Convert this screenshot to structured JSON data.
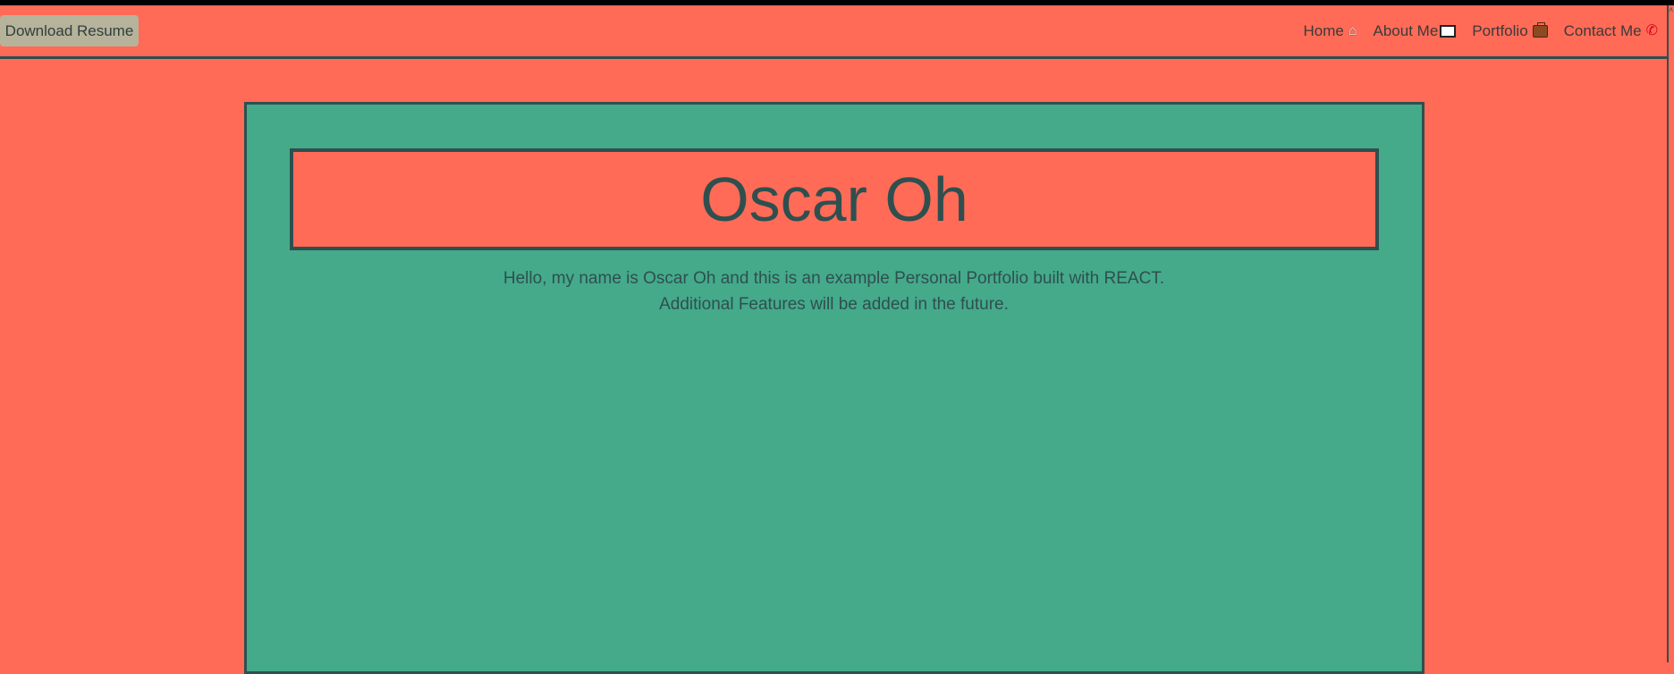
{
  "navbar": {
    "download_label": "Download Resume",
    "links": [
      {
        "label": "Home",
        "icon": "house-icon"
      },
      {
        "label": "About Me",
        "icon": "book-icon"
      },
      {
        "label": "Portfolio",
        "icon": "briefcase-icon"
      },
      {
        "label": "Contact Me",
        "icon": "phone-icon"
      }
    ]
  },
  "hero": {
    "name": "Oscar Oh",
    "intro": "Hello, my name is Oscar Oh and this is an example Personal Portfolio built with REACT. Additional Features will be added in the future."
  },
  "colors": {
    "background": "#ff6b57",
    "card": "#44aa8a",
    "border": "#2f4f4f",
    "button": "#b7b39a"
  }
}
